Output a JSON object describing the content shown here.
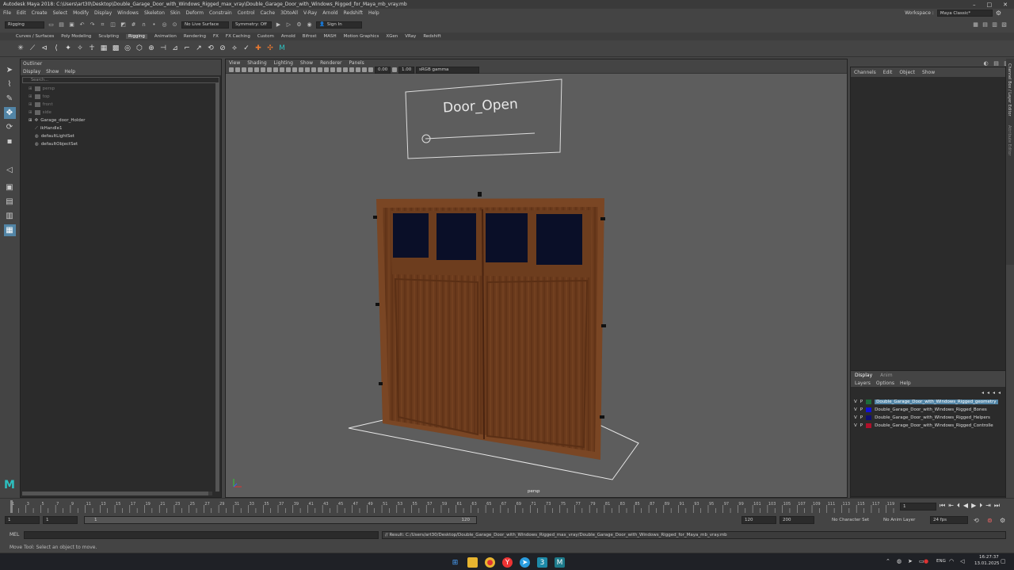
{
  "window": {
    "title": "Autodesk Maya 2018: C:\\Users\\art30\\Desktop\\Double_Garage_Door_with_Windows_Rigged_max_vray\\Double_Garage_Door_with_Windows_Rigged_for_Maya_mb_vray.mb"
  },
  "menubar": {
    "items": [
      "File",
      "Edit",
      "Create",
      "Select",
      "Modify",
      "Display",
      "Windows",
      "Skeleton",
      "Skin",
      "Deform",
      "Constrain",
      "Control",
      "Cache",
      "3DtoAll",
      "V-Ray",
      "Arnold",
      "Redshift",
      "Help"
    ],
    "workspace_label": "Workspace :",
    "workspace_value": "Maya Classic*"
  },
  "statusline": {
    "menuset": "Rigging",
    "live_surface": "No Live Surface",
    "symmetry": "Symmetry: Off",
    "sign_in": "Sign In"
  },
  "shelf": {
    "tabs": [
      "Curves / Surfaces",
      "Poly Modeling",
      "Sculpting",
      "Rigging",
      "Animation",
      "Rendering",
      "FX",
      "FX Caching",
      "Custom",
      "Arnold",
      "Bifrost",
      "MASH",
      "Motion Graphics",
      "XGen",
      "VRay",
      "Redshift"
    ],
    "active_tab": "Rigging"
  },
  "outliner": {
    "title": "Outliner",
    "menu": [
      "Display",
      "Show",
      "Help"
    ],
    "search_placeholder": "Search...",
    "items": [
      {
        "label": "persp",
        "dim": true,
        "icon": "camera-icon"
      },
      {
        "label": "top",
        "dim": true,
        "icon": "camera-icon"
      },
      {
        "label": "front",
        "dim": true,
        "icon": "camera-icon"
      },
      {
        "label": "side",
        "dim": true,
        "icon": "camera-icon"
      },
      {
        "label": "Garage_door_Holder",
        "dim": false,
        "icon": "transform-icon"
      },
      {
        "label": "ikHandle1",
        "dim": false,
        "icon": "ik-handle-icon"
      },
      {
        "label": "defaultLightSet",
        "dim": false,
        "icon": "set-icon"
      },
      {
        "label": "defaultObjectSet",
        "dim": false,
        "icon": "set-icon"
      }
    ]
  },
  "viewport": {
    "menu": [
      "View",
      "Shading",
      "Lighting",
      "Show",
      "Renderer",
      "Panels"
    ],
    "exposure": "0.00",
    "gamma": "1.00",
    "color_space": "sRGB gamma",
    "camera_label": "persp",
    "control_text": "Door_Open"
  },
  "channelbox": {
    "menu": [
      "Channels",
      "Edit",
      "Object",
      "Show"
    ],
    "side_tabs": [
      "Channel Box / Layer Editor",
      "Attribute Editor"
    ]
  },
  "layers": {
    "tabs": [
      "Display",
      "Anim"
    ],
    "menu": [
      "Layers",
      "Options",
      "Help"
    ],
    "items": [
      {
        "v": "V",
        "p": "P",
        "name": "Double_Garage_Door_with_Windows_Rigged_geometry",
        "color": "#1d6b3a",
        "selected": true
      },
      {
        "v": "V",
        "p": "P",
        "name": "Double_Garage_Door_with_Windows_Rigged_Bones",
        "color": "#1010d8",
        "selected": false
      },
      {
        "v": "V",
        "p": "P",
        "name": "Double_Garage_Door_with_Windows_Rigged_Helpers",
        "color": "#101070",
        "selected": false
      },
      {
        "v": "V",
        "p": "P",
        "name": "Double_Garage_Door_with_Windows_Rigged_Controlle",
        "color": "#b0102a",
        "selected": false
      }
    ]
  },
  "timeline": {
    "ticks": [
      "1",
      "2",
      "3",
      "4",
      "5",
      "6",
      "7",
      "8",
      "9",
      "10",
      "11",
      "12",
      "13",
      "14",
      "15",
      "16",
      "17",
      "18",
      "19",
      "20",
      "21",
      "22",
      "23",
      "24",
      "25",
      "26",
      "27",
      "28",
      "29",
      "30",
      "31",
      "32",
      "33",
      "34",
      "35",
      "36",
      "37",
      "38",
      "39",
      "40",
      "41",
      "42",
      "43",
      "44",
      "45",
      "46",
      "47",
      "48",
      "49",
      "50",
      "51",
      "52",
      "53",
      "54",
      "55",
      "56",
      "57",
      "58",
      "59",
      "60",
      "61",
      "62",
      "63",
      "64",
      "65",
      "66",
      "67",
      "68",
      "69",
      "70",
      "71",
      "72",
      "73",
      "74",
      "75",
      "76",
      "77",
      "78",
      "79",
      "80",
      "81",
      "82",
      "83",
      "84",
      "85",
      "86",
      "87",
      "88",
      "89",
      "90",
      "91",
      "92",
      "93",
      "94",
      "95",
      "96",
      "97",
      "98",
      "99",
      "100",
      "101",
      "102",
      "103",
      "104",
      "105",
      "106",
      "107",
      "108",
      "109",
      "110",
      "111",
      "112",
      "113",
      "114",
      "115",
      "116",
      "117",
      "118",
      "119",
      "120"
    ],
    "current_frame": "1",
    "range_start": "1",
    "range_start2": "1",
    "slider_start": "1",
    "slider_end": "120",
    "anim_end": "120",
    "anim_end2": "200",
    "character_set": "No Character Set",
    "anim_layer": "No Anim Layer",
    "fps": "24 fps"
  },
  "command": {
    "label": "MEL",
    "result": "// Result: C:/Users/art30/Desktop/Double_Garage_Door_with_Windows_Rigged_max_vray/Double_Garage_Door_with_Windows_Rigged_for_Maya_mb_vray.mb"
  },
  "helpline": {
    "text": "Move Tool: Select an object to move."
  },
  "taskbar": {
    "lang": "ENG",
    "time": "16:27:37",
    "date": "13.01.2025"
  }
}
